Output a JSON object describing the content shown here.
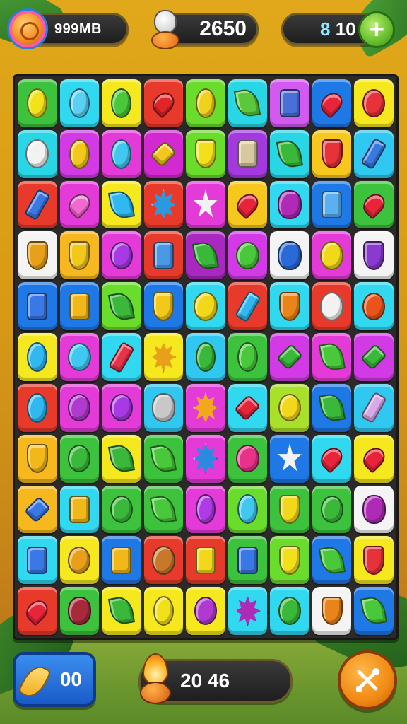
{
  "hud": {
    "coins_label": "999MB",
    "score": "2650",
    "moves_prefix": "8",
    "moves_value": "10",
    "plus_label": "+"
  },
  "board": {
    "rows": [
      [
        {
          "c": "#3cc23c",
          "g": "#f2e21a",
          "s": "oval"
        },
        {
          "c": "#30d8f0",
          "g": "#5ad0f5",
          "s": "oval"
        },
        {
          "c": "#f6e81e",
          "g": "#48c83a",
          "s": "oval"
        },
        {
          "c": "#e83a2a",
          "g": "#e0242a",
          "s": "heart"
        },
        {
          "c": "#6adc2c",
          "g": "#f0d21a",
          "s": "oval"
        },
        {
          "c": "#28d6e6",
          "g": "#5ac83a",
          "s": "leaf"
        },
        {
          "c": "#d25af0",
          "g": "#4a70d8",
          "s": "box"
        },
        {
          "c": "#1e78e6",
          "g": "#e8243a",
          "s": "heart"
        },
        {
          "c": "#f6e81e",
          "g": "#e8323a",
          "s": "circle"
        }
      ],
      [
        {
          "c": "#28d6e6",
          "g": "#f2f2f2",
          "s": "face"
        },
        {
          "c": "#d23ae6",
          "g": "#f2c81a",
          "s": "oval"
        },
        {
          "c": "#e43ad8",
          "g": "#40c8f0",
          "s": "oval"
        },
        {
          "c": "#d22ad0",
          "g": "#f0c81e",
          "s": "diamond"
        },
        {
          "c": "#6adc2c",
          "g": "#f2e01a",
          "s": "shield"
        },
        {
          "c": "#a23ae0",
          "g": "#d8c8a0",
          "s": "box"
        },
        {
          "c": "#28d6e6",
          "g": "#3ab83a",
          "s": "leaf"
        },
        {
          "c": "#f6c81e",
          "g": "#e8323a",
          "s": "shield"
        },
        {
          "c": "#30c8f0",
          "g": "#3a7ae0",
          "s": "can"
        }
      ],
      [
        {
          "c": "#e83a2a",
          "g": "#3a78e6",
          "s": "can"
        },
        {
          "c": "#e43ad8",
          "g": "#f26ad0",
          "s": "heart"
        },
        {
          "c": "#f6e81e",
          "g": "#30b8f0",
          "s": "leaf"
        },
        {
          "c": "#e83a2a",
          "g": "#2a9ae0",
          "s": "burst"
        },
        {
          "c": "#e43ad8",
          "g": "#f2f2f2",
          "s": "star"
        },
        {
          "c": "#f6c81e",
          "g": "#e8243a",
          "s": "heart"
        },
        {
          "c": "#30d8f0",
          "g": "#b02ab8",
          "s": "blob"
        },
        {
          "c": "#1e78e6",
          "g": "#5ab0f0",
          "s": "box"
        },
        {
          "c": "#3cc23c",
          "g": "#e8243a",
          "s": "heart"
        }
      ],
      [
        {
          "c": "#f4f4f4",
          "g": "#e8a01a",
          "s": "shield"
        },
        {
          "c": "#f6b81e",
          "g": "#f2c81a",
          "s": "shield"
        },
        {
          "c": "#e43ad8",
          "g": "#a83ae6",
          "s": "circle"
        },
        {
          "c": "#e83a2a",
          "g": "#4a98e6",
          "s": "box"
        },
        {
          "c": "#a828c0",
          "g": "#3ab83a",
          "s": "leaf"
        },
        {
          "c": "#d23ae6",
          "g": "#48c83a",
          "s": "circle"
        },
        {
          "c": "#f4f4f4",
          "g": "#2a6ad8",
          "s": "blob"
        },
        {
          "c": "#e43ad8",
          "g": "#f2d81a",
          "s": "face"
        },
        {
          "c": "#f4f4f4",
          "g": "#8a3ad0",
          "s": "shield"
        }
      ],
      [
        {
          "c": "#1e78e6",
          "g": "#3a78e6",
          "s": "box"
        },
        {
          "c": "#1e78e6",
          "g": "#f2b81a",
          "s": "box"
        },
        {
          "c": "#6adc2c",
          "g": "#3ab83a",
          "s": "leaf"
        },
        {
          "c": "#1e78e6",
          "g": "#f2c81a",
          "s": "shield"
        },
        {
          "c": "#30d8f0",
          "g": "#f2d81a",
          "s": "face"
        },
        {
          "c": "#e83a2a",
          "g": "#30b8f0",
          "s": "can"
        },
        {
          "c": "#30d8f0",
          "g": "#e8841a",
          "s": "shield"
        },
        {
          "c": "#e83a2a",
          "g": "#f2f2f2",
          "s": "face"
        },
        {
          "c": "#30d8f0",
          "g": "#e8541a",
          "s": "circle"
        }
      ],
      [
        {
          "c": "#f6e81e",
          "g": "#30b8f0",
          "s": "oval"
        },
        {
          "c": "#e43ad8",
          "g": "#40c8f0",
          "s": "face"
        },
        {
          "c": "#30d8f0",
          "g": "#e8324a",
          "s": "can"
        },
        {
          "c": "#f6e81e",
          "g": "#e8a01a",
          "s": "burst"
        },
        {
          "c": "#30c8f0",
          "g": "#3ab83a",
          "s": "oval"
        },
        {
          "c": "#3cc23c",
          "g": "#48c83a",
          "s": "oval"
        },
        {
          "c": "#d23ae6",
          "g": "#3ab83a",
          "s": "diamond"
        },
        {
          "c": "#e43ad8",
          "g": "#48c83a",
          "s": "leaf"
        },
        {
          "c": "#d23ae6",
          "g": "#3ab83a",
          "s": "diamond"
        }
      ],
      [
        {
          "c": "#e83a2a",
          "g": "#30b8f0",
          "s": "oval"
        },
        {
          "c": "#e43ad8",
          "g": "#b03ad0",
          "s": "circle"
        },
        {
          "c": "#e43ad8",
          "g": "#a83ae6",
          "s": "circle"
        },
        {
          "c": "#30c8f0",
          "g": "#c8c8c8",
          "s": "blob"
        },
        {
          "c": "#e43ad8",
          "g": "#f2a81a",
          "s": "burst"
        },
        {
          "c": "#30d8f0",
          "g": "#e8243a",
          "s": "diamond"
        },
        {
          "c": "#a8e02a",
          "g": "#f2d81a",
          "s": "circle"
        },
        {
          "c": "#1e78e6",
          "g": "#3ab83a",
          "s": "leaf"
        },
        {
          "c": "#30c8f0",
          "g": "#d8a8e8",
          "s": "can"
        }
      ],
      [
        {
          "c": "#f6b81e",
          "g": "#f2b81a",
          "s": "shield"
        },
        {
          "c": "#3cc23c",
          "g": "#3ab83a",
          "s": "circle"
        },
        {
          "c": "#f6e81e",
          "g": "#3ab83a",
          "s": "leaf"
        },
        {
          "c": "#3cc23c",
          "g": "#48c83a",
          "s": "leaf"
        },
        {
          "c": "#e43ad8",
          "g": "#2a8ae0",
          "s": "burst"
        },
        {
          "c": "#3cc23c",
          "g": "#e8328a",
          "s": "circle"
        },
        {
          "c": "#1e78e6",
          "g": "#f2f2f2",
          "s": "star"
        },
        {
          "c": "#30d8f0",
          "g": "#e8243a",
          "s": "heart"
        },
        {
          "c": "#f6e81e",
          "g": "#e8243a",
          "s": "heart"
        }
      ],
      [
        {
          "c": "#f6b81e",
          "g": "#3a78e6",
          "s": "diamond"
        },
        {
          "c": "#30d8f0",
          "g": "#f2b81a",
          "s": "box"
        },
        {
          "c": "#3cc23c",
          "g": "#3ab83a",
          "s": "circle"
        },
        {
          "c": "#3cc23c",
          "g": "#48c83a",
          "s": "leaf"
        },
        {
          "c": "#e43ad8",
          "g": "#b03ae6",
          "s": "oval"
        },
        {
          "c": "#6adc2c",
          "g": "#40c8f0",
          "s": "oval"
        },
        {
          "c": "#3cc23c",
          "g": "#f2d81a",
          "s": "shield"
        },
        {
          "c": "#3cc23c",
          "g": "#3ab83a",
          "s": "circle"
        },
        {
          "c": "#f4f4f4",
          "g": "#b02ab8",
          "s": "blob"
        }
      ],
      [
        {
          "c": "#30d8f0",
          "g": "#3a78e6",
          "s": "box"
        },
        {
          "c": "#f6e81e",
          "g": "#e8a01a",
          "s": "circle"
        },
        {
          "c": "#1e78e6",
          "g": "#f2b81a",
          "s": "box"
        },
        {
          "c": "#e83a2a",
          "g": "#c8782a",
          "s": "face"
        },
        {
          "c": "#e83a2a",
          "g": "#f2d81a",
          "s": "box"
        },
        {
          "c": "#3cc23c",
          "g": "#3a78e6",
          "s": "box"
        },
        {
          "c": "#6adc2c",
          "g": "#f2e01a",
          "s": "shield"
        },
        {
          "c": "#1e78e6",
          "g": "#48c83a",
          "s": "leaf"
        },
        {
          "c": "#f6e81e",
          "g": "#e8323a",
          "s": "shield"
        }
      ],
      [
        {
          "c": "#e83a2a",
          "g": "#e8243a",
          "s": "heart"
        },
        {
          "c": "#3cc23c",
          "g": "#a82a3a",
          "s": "blob"
        },
        {
          "c": "#f6e81e",
          "g": "#3ab83a",
          "s": "leaf"
        },
        {
          "c": "#f6e81e",
          "g": "#f2e01a",
          "s": "oval"
        },
        {
          "c": "#f6e81e",
          "g": "#b03ad0",
          "s": "circle"
        },
        {
          "c": "#30d8f0",
          "g": "#b02ab8",
          "s": "burst"
        },
        {
          "c": "#30d8f0",
          "g": "#3ab83a",
          "s": "circle"
        },
        {
          "c": "#f4f4f4",
          "g": "#e8841a",
          "s": "shield"
        },
        {
          "c": "#1e78e6",
          "g": "#48c83a",
          "s": "leaf"
        }
      ]
    ]
  },
  "bottom": {
    "boost_count": "00",
    "timer": "20 46",
    "settings_icon": "tools-icon"
  }
}
